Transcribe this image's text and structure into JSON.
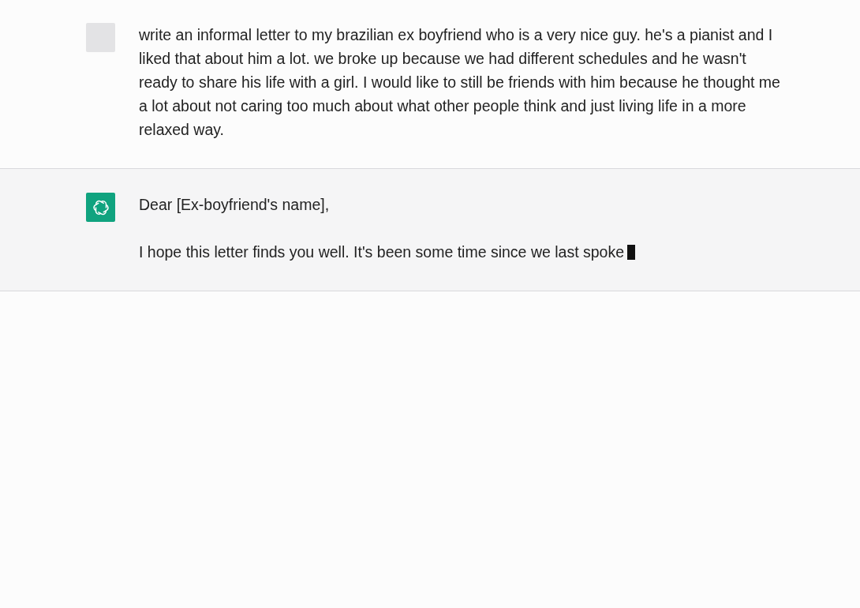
{
  "messages": [
    {
      "kind": "user",
      "paragraphs": [
        "write an informal letter to my brazilian ex boyfriend who is a very nice guy. he's a pianist and I liked that about him a lot. we broke up because we had different schedules and he wasn't ready to share his life with a girl. I would like to still be friends with him because he thought me a lot about not caring too much about what other people think and just living life in a more relaxed way."
      ],
      "streaming": false
    },
    {
      "kind": "assistant",
      "paragraphs": [
        "Dear [Ex-boyfriend's name],",
        "I hope this letter finds you well. It's been some time since we last spoke"
      ],
      "streaming": true
    }
  ]
}
